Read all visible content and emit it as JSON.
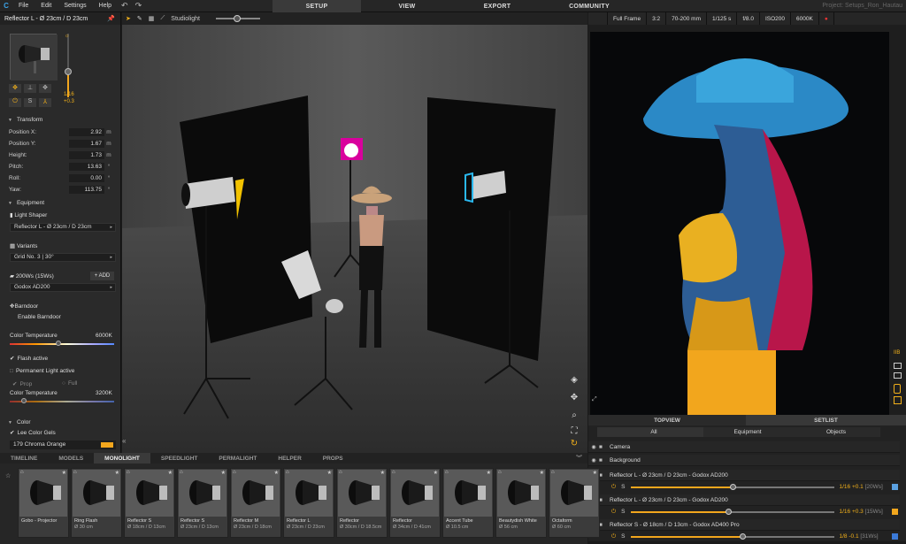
{
  "menubar": {
    "items": [
      "File",
      "Edit",
      "Settings",
      "Help"
    ],
    "undo_icon": "undo-icon",
    "redo_icon": "redo-icon"
  },
  "top_tabs": [
    {
      "label": "SETUP",
      "active": true
    },
    {
      "label": "VIEW",
      "active": false
    },
    {
      "label": "EXPORT",
      "active": false
    },
    {
      "label": "COMMUNITY",
      "active": false
    }
  ],
  "project_name": "Project: Setups_Ron_Hautau",
  "left_panel": {
    "title": "Reflector L - Ø 23cm / D 23cm",
    "power_ratio": "1/16",
    "power_offset": "+0.3",
    "transform": {
      "title": "Transform",
      "rows": [
        {
          "label": "Position X:",
          "value": "2.92",
          "unit": "m"
        },
        {
          "label": "Position Y:",
          "value": "1.67",
          "unit": "m"
        },
        {
          "label": "Height:",
          "value": "1.73",
          "unit": "m"
        },
        {
          "label": "Pitch:",
          "value": "13.63",
          "unit": "°"
        },
        {
          "label": "Roll:",
          "value": "0.00",
          "unit": "°"
        },
        {
          "label": "Yaw:",
          "value": "113.75",
          "unit": "°"
        }
      ]
    },
    "equipment": {
      "title": "Equipment",
      "light_shaper_label": "Light Shaper",
      "light_shaper_value": "Reflector L - Ø 23cm / D 23cm",
      "variants_label": "Variants",
      "variants_value": "Grid No. 3 | 30°",
      "power_label": "200Ws (15Ws)",
      "add_label": "+ ADD",
      "flash_value": "Godox AD200",
      "barndoor_label": "Barndoor",
      "enable_barndoor_label": "Enable Barndoor",
      "color_temp_label": "Color Temperature",
      "color_temp_value": "6000K",
      "flash_active_label": "Flash active",
      "permanent_light_label": "Permanent Light active",
      "prop_label": "Prop",
      "full_label": "Full",
      "color_temp2_label": "Color Temperature",
      "color_temp2_value": "3200K"
    },
    "color": {
      "title": "Color",
      "gels_label": "Lee Color Gels",
      "gel_value": "179 Chroma Orange",
      "gel_color": "#f2a61d"
    }
  },
  "viewport_toolbar": {
    "studiolight_label": "Studiolight"
  },
  "camera_toolbar": {
    "items": [
      "Full Frame",
      "3:2",
      "70-200 mm",
      "1/125 s",
      "f/8.0",
      "ISO200",
      "6000K"
    ]
  },
  "setlist": {
    "tabs": [
      {
        "label": "TOPVIEW",
        "active": false
      },
      {
        "label": "SETLIST",
        "active": true
      }
    ],
    "subtabs": [
      {
        "label": "All",
        "active": true
      },
      {
        "label": "Equipment",
        "active": false
      },
      {
        "label": "Objects",
        "active": false
      }
    ],
    "rows": [
      {
        "name": "Camera"
      },
      {
        "name": "Background"
      }
    ],
    "lights": [
      {
        "name": "Reflector L - Ø 23cm / D 23cm - Godox AD200",
        "ratio": "1/16",
        "offset": "+0.1",
        "power": "[20Ws]",
        "power_fraction": 0.5,
        "color": "#5aa0e0"
      },
      {
        "name": "Reflector L - Ø 23cm / D 23cm - Godox AD200",
        "ratio": "1/16",
        "offset": "+0.3",
        "power": "[15Ws]",
        "power_fraction": 0.48,
        "color": "#f2a61d"
      },
      {
        "name": "Reflector S - Ø 18cm / D 13cm - Godox AD400 Pro",
        "ratio": "1/8",
        "offset": "-0.1",
        "power": "[31Ws]",
        "power_fraction": 0.55,
        "color": "#3b7ad8"
      }
    ]
  },
  "library": {
    "tabs": [
      {
        "label": "TIMELINE",
        "active": false
      },
      {
        "label": "MODELS",
        "active": false
      },
      {
        "label": "MONOLIGHT",
        "active": true
      },
      {
        "label": "SPEEDLIGHT",
        "active": false
      },
      {
        "label": "PERMALIGHT",
        "active": false
      },
      {
        "label": "HELPER",
        "active": false
      },
      {
        "label": "PROPS",
        "active": false
      }
    ],
    "cards": [
      {
        "name": "Gobo - Projector",
        "sub": ""
      },
      {
        "name": "Ring Flash",
        "sub": "Ø 30 cm"
      },
      {
        "name": "Reflector S",
        "sub": "Ø 18cm / D 13cm"
      },
      {
        "name": "Reflector S",
        "sub": "Ø 23cm / D 13cm"
      },
      {
        "name": "Reflector M",
        "sub": "Ø 23cm / D 18cm"
      },
      {
        "name": "Reflector L",
        "sub": "Ø 23cm / D 23cm"
      },
      {
        "name": "Reflector",
        "sub": "Ø 30cm / D 18.5cm"
      },
      {
        "name": "Reflector",
        "sub": "Ø 34cm / D 41cm"
      },
      {
        "name": "Accent Tube",
        "sub": "Ø 10.5 cm"
      },
      {
        "name": "Beautydish White",
        "sub": "Ø 56 cm"
      },
      {
        "name": "Octaform",
        "sub": "Ø 60 cm"
      }
    ]
  },
  "accent_color": "#f2a61d"
}
